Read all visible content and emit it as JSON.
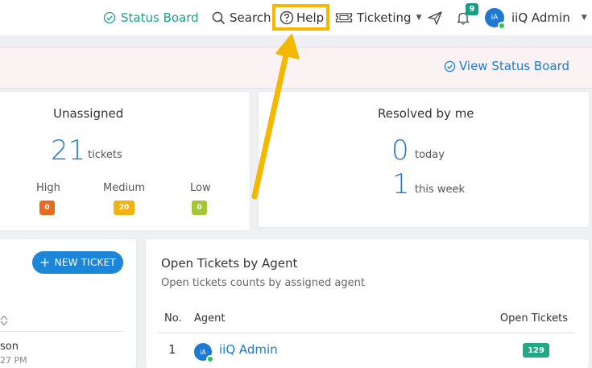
{
  "nav": {
    "status_board": "Status Board",
    "search": "Search",
    "help": "Help",
    "ticketing": "Ticketing",
    "notifications_count": "9",
    "user_initials": "iA",
    "user_name": "iiQ Admin"
  },
  "banner": {
    "link": "View Status Board"
  },
  "unassigned": {
    "title": "Unassigned",
    "count": "21",
    "count_label": "tickets",
    "priorities": [
      {
        "label": "High",
        "count": "0",
        "color": "#e86a1e"
      },
      {
        "label": "Medium",
        "count": "20",
        "color": "#f2b312"
      },
      {
        "label": "Low",
        "count": "0",
        "color": "#a6c63a"
      }
    ]
  },
  "resolved": {
    "title": "Resolved by me",
    "today_count": "0",
    "today_label": "today",
    "week_count": "1",
    "week_label": "this week"
  },
  "my_tickets": {
    "new_ticket_label": "NEW TICKET",
    "row_fragment": "son",
    "row_time_fragment": "27 PM"
  },
  "open_by_agent": {
    "title": "Open Tickets by Agent",
    "subtitle": "Open tickets counts by assigned agent",
    "columns": [
      "No.",
      "Agent",
      "Open Tickets"
    ],
    "rows": [
      {
        "no": "1",
        "initials": "iA",
        "agent": "iiQ Admin",
        "open": "129"
      }
    ]
  },
  "colors": {
    "accent": "#1e7ad1",
    "status_green": "#1fa08a",
    "highlight": "#f5b800"
  }
}
